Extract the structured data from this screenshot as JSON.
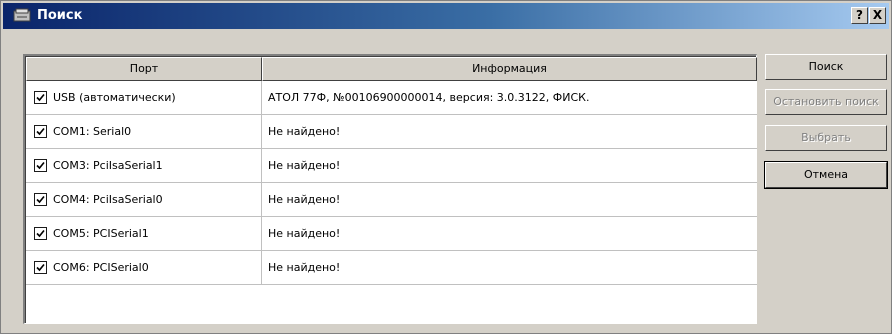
{
  "window": {
    "title": "Поиск",
    "help_label": "?",
    "close_label": "X"
  },
  "table": {
    "columns": [
      "Порт",
      "Информация"
    ],
    "rows": [
      {
        "port": "USB (автоматически)",
        "info": "АТОЛ 77Ф, №00106900000014, версия: 3.0.3122, ФИСК.",
        "checked": true
      },
      {
        "port": "COM1: Serial0",
        "info": "Не найдено!",
        "checked": true
      },
      {
        "port": "COM3: PciIsaSerial1",
        "info": "Не найдено!",
        "checked": true
      },
      {
        "port": "COM4: PciIsaSerial0",
        "info": "Не найдено!",
        "checked": true
      },
      {
        "port": "COM5: PCISerial1",
        "info": "Не найдено!",
        "checked": true
      },
      {
        "port": "COM6: PCISerial0",
        "info": "Не найдено!",
        "checked": true
      }
    ]
  },
  "buttons": {
    "search": "Поиск",
    "stop_search": "Остановить поиск",
    "select": "Выбрать",
    "cancel": "Отмена"
  }
}
